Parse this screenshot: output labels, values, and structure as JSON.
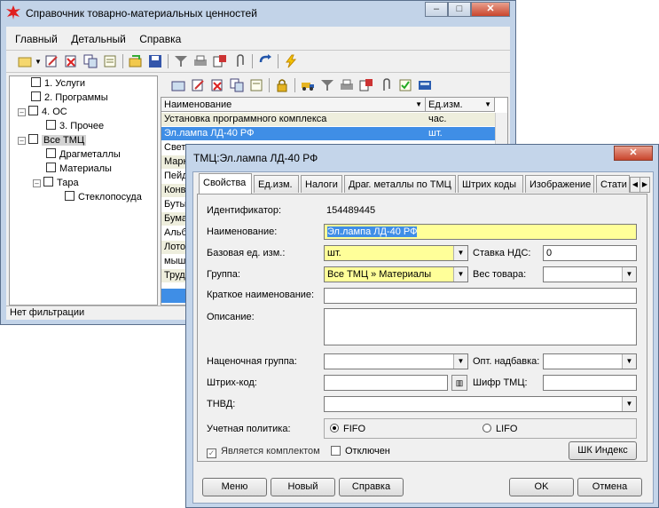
{
  "main_window": {
    "title": "Справочник товарно-материальных ценностей",
    "menu": [
      "Главный",
      "Детальный",
      "Справка"
    ],
    "tree": [
      {
        "label": "1. Услуги"
      },
      {
        "label": "2. Программы"
      },
      {
        "label": "4. ОС"
      },
      {
        "label": "3. Прочее"
      },
      {
        "label": "Все ТМЦ"
      },
      {
        "label": "Драгметаллы"
      },
      {
        "label": "Материалы"
      },
      {
        "label": "Тара"
      },
      {
        "label": "Стеклопосуда"
      }
    ],
    "grid": {
      "col_name": "Наименование",
      "col_unit": "Ед.изм.",
      "rows": [
        {
          "name": "Установка программного комплекса",
          "unit": "час."
        },
        {
          "name": "Эл.лампа ЛД-40 РФ",
          "unit": "шт."
        },
        {
          "name": "Свети",
          "unit": ""
        },
        {
          "name": "Марк",
          "unit": ""
        },
        {
          "name": "Пейд",
          "unit": ""
        },
        {
          "name": "Конв",
          "unit": ""
        },
        {
          "name": "Буты",
          "unit": ""
        },
        {
          "name": "Бума",
          "unit": ""
        },
        {
          "name": "Альб",
          "unit": ""
        },
        {
          "name": "Лото",
          "unit": ""
        },
        {
          "name": "мышк",
          "unit": ""
        },
        {
          "name": "Труд",
          "unit": ""
        }
      ]
    },
    "status": "Нет фильтрации"
  },
  "dialog": {
    "title": "ТМЦ:Эл.лампа ЛД-40 РФ",
    "tabs": [
      "Свойства",
      "Ед.изм.",
      "Налоги",
      "Драг. металлы по ТМЦ",
      "Штрих коды",
      "Изображение",
      "Стати"
    ],
    "fields": {
      "id_label": "Идентификатор:",
      "id_value": "154489445",
      "name_label": "Наименование:",
      "name_value": "Эл.лампа ЛД-40 РФ",
      "unit_label": "Базовая ед. изм.:",
      "unit_value": "шт.",
      "vat_label": "Ставка НДС:",
      "vat_value": "0",
      "group_label": "Группа:",
      "group_value": "Все ТМЦ » Материалы",
      "weight_label": "Вес товара:",
      "short_label": "Краткое наименование:",
      "desc_label": "Описание:",
      "markup_group_label": "Наценочная группа:",
      "opt_label": "Опт. надбавка:",
      "barcode_label": "Штрих-код:",
      "cipher_label": "Шифр ТМЦ:",
      "tnved_label": "ТНВД:",
      "policy_label": "Учетная политика:",
      "fifo": "FIFO",
      "lifo": "LIFO",
      "complect_label": "Является комплектом",
      "disabled_label": "Отключен",
      "shk_button": "ШК Индекс"
    },
    "buttons": {
      "menu": "Меню",
      "new": "Новый",
      "help": "Справка",
      "ok": "OK",
      "cancel": "Отмена"
    }
  }
}
